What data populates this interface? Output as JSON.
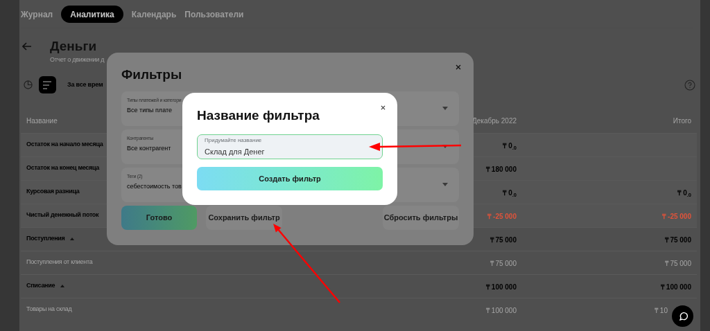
{
  "nav": {
    "tabs": [
      {
        "label": "Журнал",
        "selected": false
      },
      {
        "label": "Аналитика",
        "selected": true
      },
      {
        "label": "Календарь",
        "selected": false
      },
      {
        "label": "Пользователи",
        "selected": false
      }
    ]
  },
  "page": {
    "title": "Деньги",
    "subtitle": "Отчет о движении д",
    "period": "За все врем"
  },
  "table": {
    "columns": [
      "Название",
      "Декабрь 2022",
      "Итого"
    ],
    "rows": [
      {
        "kind": "summary",
        "name": "Остаток на начало месяца",
        "december": "₸ 0$_{.0}$",
        "negative": false
      },
      {
        "kind": "summary",
        "name": "Остаток на конец месяца",
        "december": "₸ 180 000",
        "negative": false
      },
      {
        "kind": "summary",
        "name": "Курсовая разница",
        "december": "₸ 0$_{.0}$",
        "total": "₸ 0$_{.0}$",
        "negative": false
      },
      {
        "kind": "summary",
        "name": "Чистый денежный поток",
        "december": "₸ -25 000",
        "total": "₸ -25 000",
        "negative": true
      },
      {
        "kind": "group",
        "name": "Поступления",
        "expanded": true,
        "december": "₸ 75 000",
        "total": "₸ 75 000",
        "negative": false
      },
      {
        "kind": "item",
        "name": "Поступления от клиента",
        "december": "₸ 75 000",
        "total": "₸ 75 000",
        "negative": false
      },
      {
        "kind": "group",
        "name": "Списание",
        "expanded": true,
        "december": "₸ 100 000",
        "total": "₸ 100 000",
        "negative": false
      },
      {
        "kind": "item",
        "name": "Товары на склад",
        "december": "₸ 100 000",
        "total": "₸ 10",
        "negative": false
      }
    ]
  },
  "filters_dialog": {
    "title": "Фильтры",
    "fields": [
      {
        "label": "Типы платежей и категори",
        "value": "Все типы плате"
      },
      {
        "label": "Контрагенты",
        "value": "Все контрагент"
      },
      {
        "label": "Теги (2)",
        "value": "себестоимость тов"
      }
    ],
    "buttons": [
      {
        "label": "Готово",
        "kind": "primary"
      },
      {
        "label": "Сохранить фильтр",
        "kind": "secondary"
      },
      {
        "label": "Сбросить фильтры",
        "kind": "secondary"
      }
    ]
  },
  "name_dialog": {
    "title": "Название фильтра",
    "field": {
      "label": "Придумайте название",
      "value": "Склад для Денег"
    },
    "button": "Создать фильтр"
  }
}
